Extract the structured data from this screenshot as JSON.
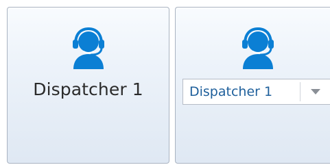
{
  "tiles": [
    {
      "icon": "headset-operator-icon",
      "label": "Dispatcher 1",
      "mode": "static"
    },
    {
      "icon": "headset-operator-icon",
      "selected_value": "Dispatcher 1",
      "dropdown_icon": "chevron-down-icon",
      "mode": "dropdown"
    }
  ],
  "colors": {
    "icon": "#0b7fd4",
    "select_text": "#1e5f9b",
    "tile_border": "#a9b3c1"
  }
}
